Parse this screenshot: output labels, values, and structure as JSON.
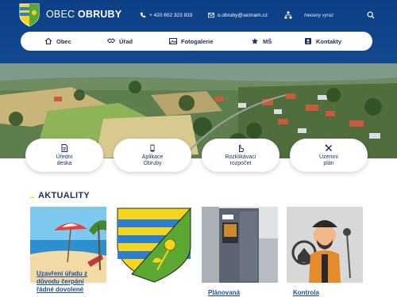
{
  "header": {
    "name_light": "OBEC",
    "name_bold": "OBRUBY",
    "phone": "+ 420 602 323 933",
    "email": "o.obruby@seznam.cz",
    "search_placeholder": "hledaný výraz",
    "icons": {
      "logo": "crest-logo",
      "phone": "phone-icon",
      "email": "envelope-icon",
      "sitemap": "sitemap-icon",
      "search": "search-icon"
    }
  },
  "nav": {
    "items": [
      {
        "label": "Obec",
        "icon": "home-icon"
      },
      {
        "label": "Úřad",
        "icon": "handshake-icon"
      },
      {
        "label": "Fotogalerie",
        "icon": "gallery-icon"
      },
      {
        "label": "MŠ",
        "icon": "school-icon"
      },
      {
        "label": "Kontakty",
        "icon": "contacts-icon"
      }
    ]
  },
  "tiles": [
    {
      "line1": "Úřední",
      "line2": "deska",
      "icon": "document-icon"
    },
    {
      "line1": "Aplikace",
      "line2": "Obruby",
      "icon": "phone-app-icon"
    },
    {
      "line1": "Rozklikávací",
      "line2": "rozpočet",
      "icon": "pointer-icon"
    },
    {
      "line1": "Územní",
      "line2": "plán",
      "icon": "tools-icon"
    }
  ],
  "news": {
    "title": "AKTUALITY",
    "cards": [
      {
        "text1": "Uzavření úřadu z",
        "text2": "důvodu čerpání",
        "text3": "řádné dovolené"
      },
      {
        "text1": ""
      },
      {
        "text1": "Plánovaná"
      },
      {
        "text1": "Kontrola"
      }
    ]
  },
  "colors": {
    "header_blue": "#0d3f86",
    "nav_text": "#1b2f5c",
    "link_blue": "#1b4d9e",
    "accent_green": "#6db33f",
    "accent_yellow": "#f3d51e"
  }
}
